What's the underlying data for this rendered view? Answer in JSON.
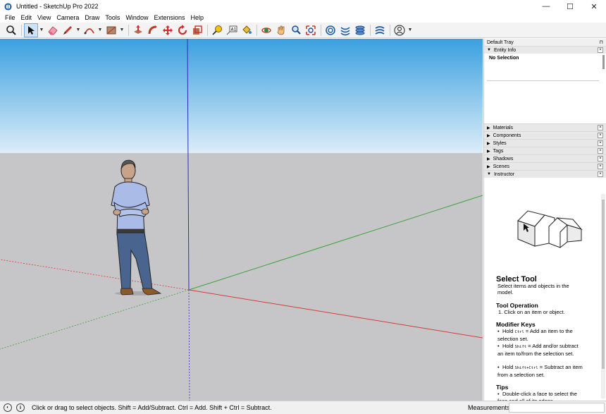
{
  "window": {
    "title": "Untitled - SketchUp Pro 2022",
    "minimize": "—",
    "maximize": "☐",
    "close": "✕"
  },
  "menubar": {
    "items": [
      "File",
      "Edit",
      "View",
      "Camera",
      "Draw",
      "Tools",
      "Window",
      "Extensions",
      "Help"
    ]
  },
  "toolbar": {
    "tools": [
      "search",
      "select",
      "eraser",
      "line",
      "arc",
      "shape",
      "push-pull",
      "follow-me",
      "move",
      "rotate",
      "scale",
      "tape-measure",
      "text",
      "paint-bucket",
      "orbit",
      "pan",
      "zoom",
      "zoom-extents",
      "warehouse",
      "extension-warehouse",
      "layout",
      "sandbox",
      "account"
    ]
  },
  "tray": {
    "title": "Default Tray",
    "pin": "⊓",
    "entity_info": {
      "label": "Entity Info",
      "value": "No Selection"
    },
    "panels": [
      "Materials",
      "Components",
      "Styles",
      "Tags",
      "Shadows",
      "Scenes",
      "Instructor"
    ],
    "instructor": {
      "title": "Select Tool",
      "description": "Select items and objects in the model.",
      "operation_heading": "Tool Operation",
      "operation_text": "1. Click on an item or object.",
      "modifier_heading": "Modifier Keys",
      "modifiers": [
        {
          "pre": "Hold ",
          "key": "Ctrl",
          "post": " = Add an item to the selection set."
        },
        {
          "pre": "Hold ",
          "key": "Shift",
          "post": " = Add and/or subtract an item to/from the selection set."
        },
        {
          "pre": "Hold ",
          "key": "Shift+Ctrl",
          "post": " = Subtract an item from a selection set."
        }
      ],
      "tips_heading": "Tips",
      "tips": [
        "Double-click a face to select the face and all of its edges."
      ]
    }
  },
  "statusbar": {
    "message": "Click or drag to select objects. Shift = Add/Subtract. Ctrl = Add. Shift + Ctrl = Subtract.",
    "measurements_label": "Measurements",
    "measurements_value": ""
  },
  "colors": {
    "sky_top": "#3fa3e1",
    "sky_bottom": "#d6ecf8",
    "ground": "#c6c6c9",
    "axis_red": "#d23c3c",
    "axis_green": "#3da33d",
    "axis_blue": "#2d2dbd"
  }
}
